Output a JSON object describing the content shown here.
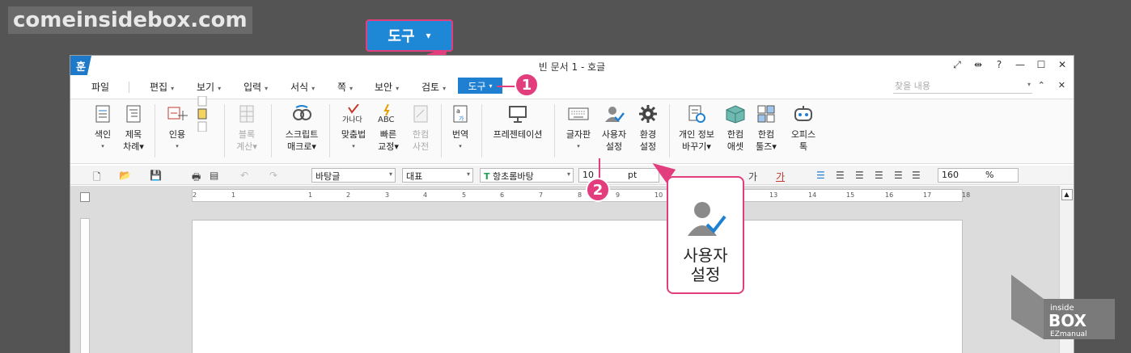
{
  "watermark": {
    "site": "comeinsidebox.com"
  },
  "callout_top": {
    "label": "도구",
    "caret": "▾"
  },
  "window": {
    "logo": "훈",
    "title": "빈 문서 1 - 호글",
    "title_ctrls": [
      "⤢",
      "⇹",
      "?",
      "—",
      "☐",
      "✕"
    ]
  },
  "menubar": {
    "items": [
      {
        "label": "파일",
        "has_dropdown": false
      },
      {
        "label": "편집",
        "has_dropdown": true
      },
      {
        "label": "보기",
        "has_dropdown": true
      },
      {
        "label": "입력",
        "has_dropdown": true
      },
      {
        "label": "서식",
        "has_dropdown": true
      },
      {
        "label": "쪽",
        "has_dropdown": true
      },
      {
        "label": "보안",
        "has_dropdown": true
      },
      {
        "label": "검토",
        "has_dropdown": true
      }
    ],
    "active": "도구",
    "dropdown_glyph": "▾",
    "search_placeholder": "찾을 내용",
    "right_ctrls": [
      "▾",
      "⌃",
      "✕"
    ]
  },
  "badges": {
    "one": "1",
    "two": "2"
  },
  "ribbon": {
    "groups": [
      {
        "line1": "색인",
        "line2": "▾"
      },
      {
        "line1": "제목",
        "line2": "차례▾"
      },
      {
        "line1": "인용",
        "line2": "▾"
      },
      {
        "line1": "블록",
        "line2": "계산▾"
      },
      {
        "line1": "스크립트",
        "line2": "매크로▾"
      },
      {
        "line1": "맞춤법",
        "line2": "▾"
      },
      {
        "line1": "빠른",
        "line2": "교정▾"
      },
      {
        "line1": "한컴",
        "line2": "사전"
      },
      {
        "line1": "번역",
        "line2": "▾"
      },
      {
        "line1": "프레젠테이션",
        "line2": ""
      },
      {
        "line1": "글자판",
        "line2": "▾"
      },
      {
        "line1": "사용자",
        "line2": "설정"
      },
      {
        "line1": "환경",
        "line2": "설정"
      },
      {
        "line1": "개인 정보",
        "line2": "바꾸기▾"
      },
      {
        "line1": "한컴",
        "line2": "애셋"
      },
      {
        "line1": "한컴",
        "line2": "툴즈▾"
      },
      {
        "line1": "오피스",
        "line2": "톡"
      }
    ]
  },
  "toolbar2": {
    "style": "바탕글",
    "lang": "대표",
    "font": "항초롬바탕",
    "font_icon": "T",
    "size": "10",
    "size_unit": "pt",
    "fmt1": "가",
    "fmt2": "가",
    "zoom": "160",
    "zoom_unit": "%"
  },
  "ruler": {
    "ticks": [
      "2",
      "1",
      "",
      "1",
      "2",
      "3",
      "4",
      "5",
      "6",
      "7",
      "8",
      "9",
      "10",
      "11",
      "12",
      "13",
      "14",
      "15",
      "16",
      "17",
      "18"
    ]
  },
  "zoom_callout": {
    "line1": "사용자",
    "line2": "설정"
  },
  "box_logo": {
    "line1": "inside",
    "line2": "BOX",
    "line3": "EZmanual"
  },
  "colors": {
    "accent": "#1f7fd0",
    "highlight": "#e23d7c",
    "background": "#545454"
  }
}
